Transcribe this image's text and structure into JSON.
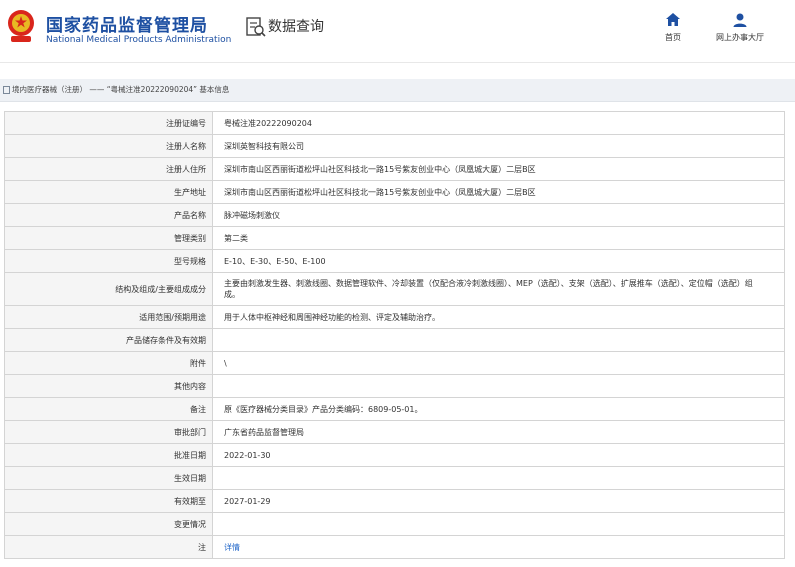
{
  "header": {
    "brand_cn": "国家药品监督管理局",
    "brand_en": "National Medical Products Administration",
    "query_title": "数据查询",
    "nav": [
      {
        "label": "首页",
        "icon": "home-icon"
      },
      {
        "label": "网上办事大厅",
        "icon": "user-icon"
      }
    ]
  },
  "breadcrumb": {
    "path": "境内医疗器械（注册）",
    "sep": " —— ",
    "current": "“粤械注准20222090204” 基本信息"
  },
  "colors": {
    "brand": "#1e50a2",
    "link": "#1e64c8",
    "key_bg": "#f5f5f5",
    "border": "#d4d4d4"
  },
  "rows": [
    {
      "key": "注册证编号",
      "value": "粤械注准20222090204"
    },
    {
      "key": "注册人名称",
      "value": "深圳英智科技有限公司"
    },
    {
      "key": "注册人住所",
      "value": "深圳市南山区西丽街道松坪山社区科技北一路15号紫友创业中心（凤凰城大厦）二层B区"
    },
    {
      "key": "生产地址",
      "value": "深圳市南山区西丽街道松坪山社区科技北一路15号紫友创业中心（凤凰城大厦）二层B区"
    },
    {
      "key": "产品名称",
      "value": "脉冲磁场刺激仪"
    },
    {
      "key": "管理类别",
      "value": "第二类"
    },
    {
      "key": "型号规格",
      "value": "E-10、E-30、E-50、E-100"
    },
    {
      "key": "结构及组成/主要组成成分",
      "value": "主要由刺激发生器、刺激线圈、数据管理软件、冷却装置（仅配合液冷刺激线圈）、MEP（选配）、支架（选配）、扩展推车（选配）、定位帽（选配）组成。"
    },
    {
      "key": "适用范围/预期用途",
      "value": "用于人体中枢神经和周围神经功能的检测、评定及辅助治疗。"
    },
    {
      "key": "产品储存条件及有效期",
      "value": ""
    },
    {
      "key": "附件",
      "value": "\\"
    },
    {
      "key": "其他内容",
      "value": ""
    },
    {
      "key": "备注",
      "value": "原《医疗器械分类目录》产品分类编码：6809-05-01。"
    },
    {
      "key": "审批部门",
      "value": "广东省药品监督管理局"
    },
    {
      "key": "批准日期",
      "value": "2022-01-30"
    },
    {
      "key": "生效日期",
      "value": ""
    },
    {
      "key": "有效期至",
      "value": "2027-01-29"
    },
    {
      "key": "变更情况",
      "value": ""
    },
    {
      "key": "注",
      "value": "详情"
    }
  ]
}
